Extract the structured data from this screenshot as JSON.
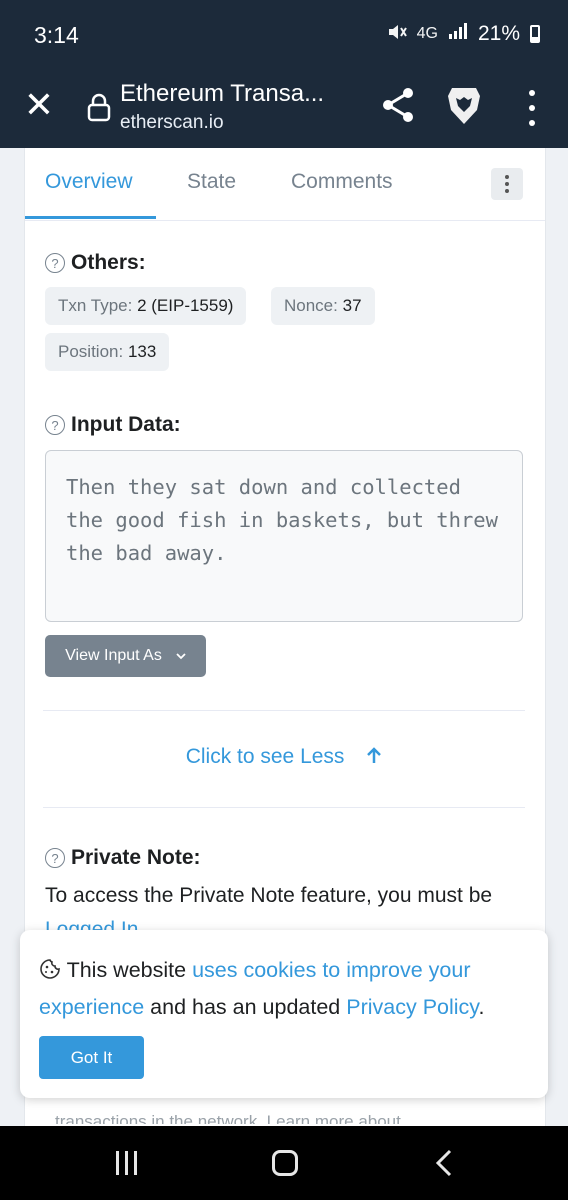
{
  "status_bar": {
    "time": "3:14",
    "network": "4G",
    "battery": "21%",
    "icons": [
      "mute-icon",
      "network-4g-icon",
      "signal-icon",
      "battery-icon"
    ]
  },
  "browser": {
    "title": "Ethereum Transa...",
    "url": "etherscan.io",
    "icons": [
      "close-icon",
      "lock-icon",
      "share-icon",
      "brave-lion-icon",
      "more-vert-icon"
    ]
  },
  "tabs": [
    {
      "label": "Overview",
      "active": true
    },
    {
      "label": "State",
      "active": false
    },
    {
      "label": "Comments",
      "active": false
    }
  ],
  "others": {
    "title": "Others:",
    "txn_type": {
      "label": "Txn Type:",
      "value": "2 (EIP-1559)"
    },
    "nonce": {
      "label": "Nonce:",
      "value": "37"
    },
    "position": {
      "label": "Position:",
      "value": "133"
    }
  },
  "input_data": {
    "title": "Input Data:",
    "value": "Then they sat down and collected the good fish in baskets, but threw the bad away.",
    "view_button": "View Input As"
  },
  "see_less": "Click to see Less",
  "private_note": {
    "title": "Private Note:",
    "text": "To access the Private Note feature, you must be",
    "link": "Logged In"
  },
  "cookie_banner": {
    "text_1": "This website",
    "link_1": "uses cookies to improve your experience",
    "text_2": "and has an updated",
    "link_2": "Privacy Policy",
    "text_3": ".",
    "button": "Got It"
  },
  "partial_text": "transactions in the network. Learn more about",
  "colors": {
    "header_bg": "#1c2a3a",
    "accent": "#3498db",
    "muted": "#77838f"
  }
}
